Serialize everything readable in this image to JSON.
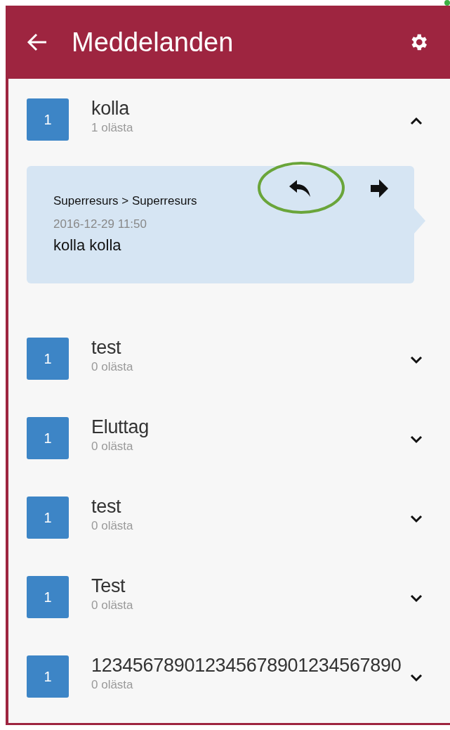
{
  "header": {
    "title": "Meddelanden"
  },
  "threads": [
    {
      "count": "1",
      "title": "kolla",
      "unread": "1 olästa",
      "expanded": true,
      "message": {
        "route": "Superresurs > Superresurs",
        "time": "2016-12-29 11:50",
        "text": "kolla kolla",
        "reply_highlighted": true
      }
    },
    {
      "count": "1",
      "title": "test",
      "unread": "0 olästa",
      "expanded": false
    },
    {
      "count": "1",
      "title": "Eluttag",
      "unread": "0 olästa",
      "expanded": false
    },
    {
      "count": "1",
      "title": "test",
      "unread": "0 olästa",
      "expanded": false
    },
    {
      "count": "1",
      "title": "Test",
      "unread": "0 olästa",
      "expanded": false
    },
    {
      "count": "1",
      "title": "123456789012345678901234567890",
      "unread": "0 olästa",
      "expanded": false
    }
  ]
}
